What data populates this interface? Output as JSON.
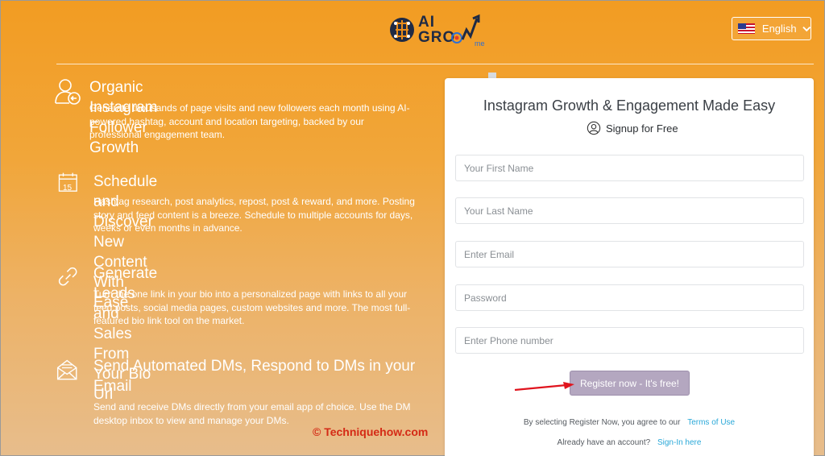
{
  "header": {
    "logo_ai": "AI",
    "logo_grow": "GRO",
    "logo_suffix": "me",
    "language_label": "English"
  },
  "features": [
    {
      "title": "Organic Instagram Follower Growth",
      "description": "Generate thousands of page visits and new followers each month using AI-powered hashtag, account and location targeting, backed by our professional engagement team."
    },
    {
      "title": "Schedule and Discover New Content With Ease",
      "calendar_day": "15",
      "description": "Hashtag research, post analytics, repost, post & reward, and more. Posting story and feed content is a breeze. Schedule to multiple accounts for days, weeks or even months in advance."
    },
    {
      "title": "Generate Leads and Sales From Your Bio Url",
      "description": "Turn the one link in your bio into a personalized page with links to all your feed posts, social media pages, custom websites and more. The most full-featured bio link tool on the market."
    },
    {
      "title": "Send Automated DMs, Respond to DMs in your Email",
      "description": "Send and receive DMs directly from your email app of choice. Use the DM desktop inbox to view and manage your DMs."
    }
  ],
  "signup": {
    "title": "Instagram Growth & Engagement Made Easy",
    "subtitle": "Signup for Free",
    "first_name_placeholder": "Your First Name",
    "last_name_placeholder": "Your Last Name",
    "email_placeholder": "Enter Email",
    "password_placeholder": "Password",
    "phone_placeholder": "Enter Phone number",
    "register_label": "Register now - It's free!",
    "terms_text": "By selecting Register Now, you agree to our",
    "terms_link": "Terms of Use",
    "account_text": "Already have an account?",
    "signin_link": "Sign-In here"
  },
  "watermark": "© Techniquehow.com",
  "colors": {
    "background_top": "#f29c22",
    "background_bottom": "#e7bd8c",
    "register_button": "#b4a7c0",
    "link": "#2aa8d8",
    "watermark": "#d42a16"
  }
}
